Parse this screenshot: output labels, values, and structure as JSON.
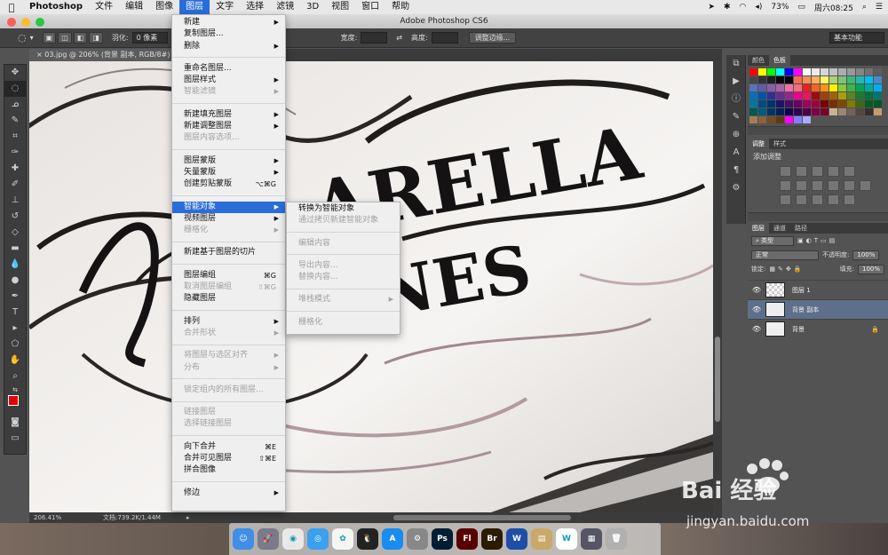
{
  "menubar": {
    "app_name": "Photoshop",
    "items": [
      "文件",
      "编辑",
      "图像",
      "图层",
      "文字",
      "选择",
      "滤镜",
      "3D",
      "视图",
      "窗口",
      "帮助"
    ],
    "active_item": "图层",
    "battery": "73%",
    "clock": "周六08:25"
  },
  "window": {
    "title": "Adobe Photoshop CS6"
  },
  "options_bar": {
    "feather_label": "羽化:",
    "feather_value": "0 像素",
    "width_label": "宽度:",
    "height_label": "高度:",
    "refine_edge_button": "调整边缘...",
    "workspace": "基本功能"
  },
  "document": {
    "tab_title": "03.jpg @ 206% (背景 副本, RGB/8#)",
    "zoom": "206.41%",
    "doc_size": "文档:739.2K/1.44M"
  },
  "layer_menu": {
    "items": [
      {
        "label": "新建",
        "shortcut": "",
        "submenu": true,
        "disabled": false
      },
      {
        "label": "复制图层...",
        "shortcut": "",
        "submenu": false,
        "disabled": false
      },
      {
        "label": "删除",
        "shortcut": "",
        "submenu": true,
        "disabled": false
      },
      {
        "sep": true
      },
      {
        "label": "重命名图层...",
        "shortcut": "",
        "submenu": false,
        "disabled": false
      },
      {
        "label": "图层样式",
        "shortcut": "",
        "submenu": true,
        "disabled": false
      },
      {
        "label": "智能滤镜",
        "shortcut": "",
        "submenu": true,
        "disabled": true
      },
      {
        "sep": true
      },
      {
        "label": "新建填充图层",
        "shortcut": "",
        "submenu": true,
        "disabled": false
      },
      {
        "label": "新建调整图层",
        "shortcut": "",
        "submenu": true,
        "disabled": false
      },
      {
        "label": "图层内容选项...",
        "shortcut": "",
        "submenu": false,
        "disabled": true
      },
      {
        "sep": true
      },
      {
        "label": "图层蒙版",
        "shortcut": "",
        "submenu": true,
        "disabled": false
      },
      {
        "label": "矢量蒙版",
        "shortcut": "",
        "submenu": true,
        "disabled": false
      },
      {
        "label": "创建剪贴蒙版",
        "shortcut": "⌥⌘G",
        "submenu": false,
        "disabled": false
      },
      {
        "sep": true
      },
      {
        "label": "智能对象",
        "shortcut": "",
        "submenu": true,
        "disabled": false,
        "highlighted": true
      },
      {
        "label": "视频图层",
        "shortcut": "",
        "submenu": true,
        "disabled": false
      },
      {
        "label": "栅格化",
        "shortcut": "",
        "submenu": true,
        "disabled": true
      },
      {
        "sep": true
      },
      {
        "label": "新建基于图层的切片",
        "shortcut": "",
        "submenu": false,
        "disabled": false
      },
      {
        "sep": true
      },
      {
        "label": "图层编组",
        "shortcut": "⌘G",
        "submenu": false,
        "disabled": false
      },
      {
        "label": "取消图层编组",
        "shortcut": "⇧⌘G",
        "submenu": false,
        "disabled": true
      },
      {
        "label": "隐藏图层",
        "shortcut": "",
        "submenu": false,
        "disabled": false
      },
      {
        "sep": true
      },
      {
        "label": "排列",
        "shortcut": "",
        "submenu": true,
        "disabled": false
      },
      {
        "label": "合并形状",
        "shortcut": "",
        "submenu": true,
        "disabled": true
      },
      {
        "sep": true
      },
      {
        "label": "将图层与选区对齐",
        "shortcut": "",
        "submenu": true,
        "disabled": true
      },
      {
        "label": "分布",
        "shortcut": "",
        "submenu": true,
        "disabled": true
      },
      {
        "sep": true
      },
      {
        "label": "锁定组内的所有图层...",
        "shortcut": "",
        "submenu": false,
        "disabled": true
      },
      {
        "sep": true
      },
      {
        "label": "链接图层",
        "shortcut": "",
        "submenu": false,
        "disabled": true
      },
      {
        "label": "选择链接图层",
        "shortcut": "",
        "submenu": false,
        "disabled": true
      },
      {
        "sep": true
      },
      {
        "label": "向下合并",
        "shortcut": "⌘E",
        "submenu": false,
        "disabled": false
      },
      {
        "label": "合并可见图层",
        "shortcut": "⇧⌘E",
        "submenu": false,
        "disabled": false
      },
      {
        "label": "拼合图像",
        "shortcut": "",
        "submenu": false,
        "disabled": false
      },
      {
        "sep": true
      },
      {
        "label": "修边",
        "shortcut": "",
        "submenu": true,
        "disabled": false
      }
    ]
  },
  "smart_object_submenu": {
    "items": [
      {
        "label": "转换为智能对象",
        "submenu": false,
        "disabled": false
      },
      {
        "label": "通过拷贝新建智能对象",
        "submenu": false,
        "disabled": true
      },
      {
        "sep": true
      },
      {
        "label": "编辑内容",
        "submenu": false,
        "disabled": true
      },
      {
        "sep": true
      },
      {
        "label": "导出内容...",
        "submenu": false,
        "disabled": true
      },
      {
        "label": "替换内容...",
        "submenu": false,
        "disabled": true
      },
      {
        "sep": true
      },
      {
        "label": "堆栈模式",
        "submenu": true,
        "disabled": true
      },
      {
        "sep": true
      },
      {
        "label": "栅格化",
        "submenu": false,
        "disabled": true
      }
    ]
  },
  "swatches_panel": {
    "tabs": [
      "颜色",
      "色板"
    ],
    "active_tab": "色板"
  },
  "adjustments_panel": {
    "tabs": [
      "调整",
      "样式"
    ],
    "active_tab": "调整",
    "title": "添加调整"
  },
  "layers_panel": {
    "tabs": [
      "图层",
      "通道",
      "路径"
    ],
    "active_tab": "图层",
    "filter": "类型",
    "blend_mode": "正常",
    "opacity_label": "不透明度:",
    "opacity": "100%",
    "lock_label": "锁定:",
    "fill_label": "填充:",
    "fill": "100%",
    "layers": [
      {
        "name": "图层 1",
        "selected": false,
        "transparent": true,
        "locked": false
      },
      {
        "name": "背景 副本",
        "selected": true,
        "transparent": false,
        "locked": false
      },
      {
        "name": "背景",
        "selected": false,
        "transparent": false,
        "locked": true
      }
    ]
  },
  "canvas_lettering": {
    "line1": "ARELLA",
    "line2": "ONES"
  },
  "dock": [
    "Finder",
    "Launchpad",
    "Chrome",
    "Safari",
    "Photos",
    "QQ",
    "App Store",
    "System Preferences",
    "Ps",
    "Fl",
    "Br",
    "W",
    "Archive",
    "W",
    "Display",
    "Trash"
  ],
  "watermark": {
    "text": "Bai 经验",
    "url": "jingyan.baidu.com"
  }
}
